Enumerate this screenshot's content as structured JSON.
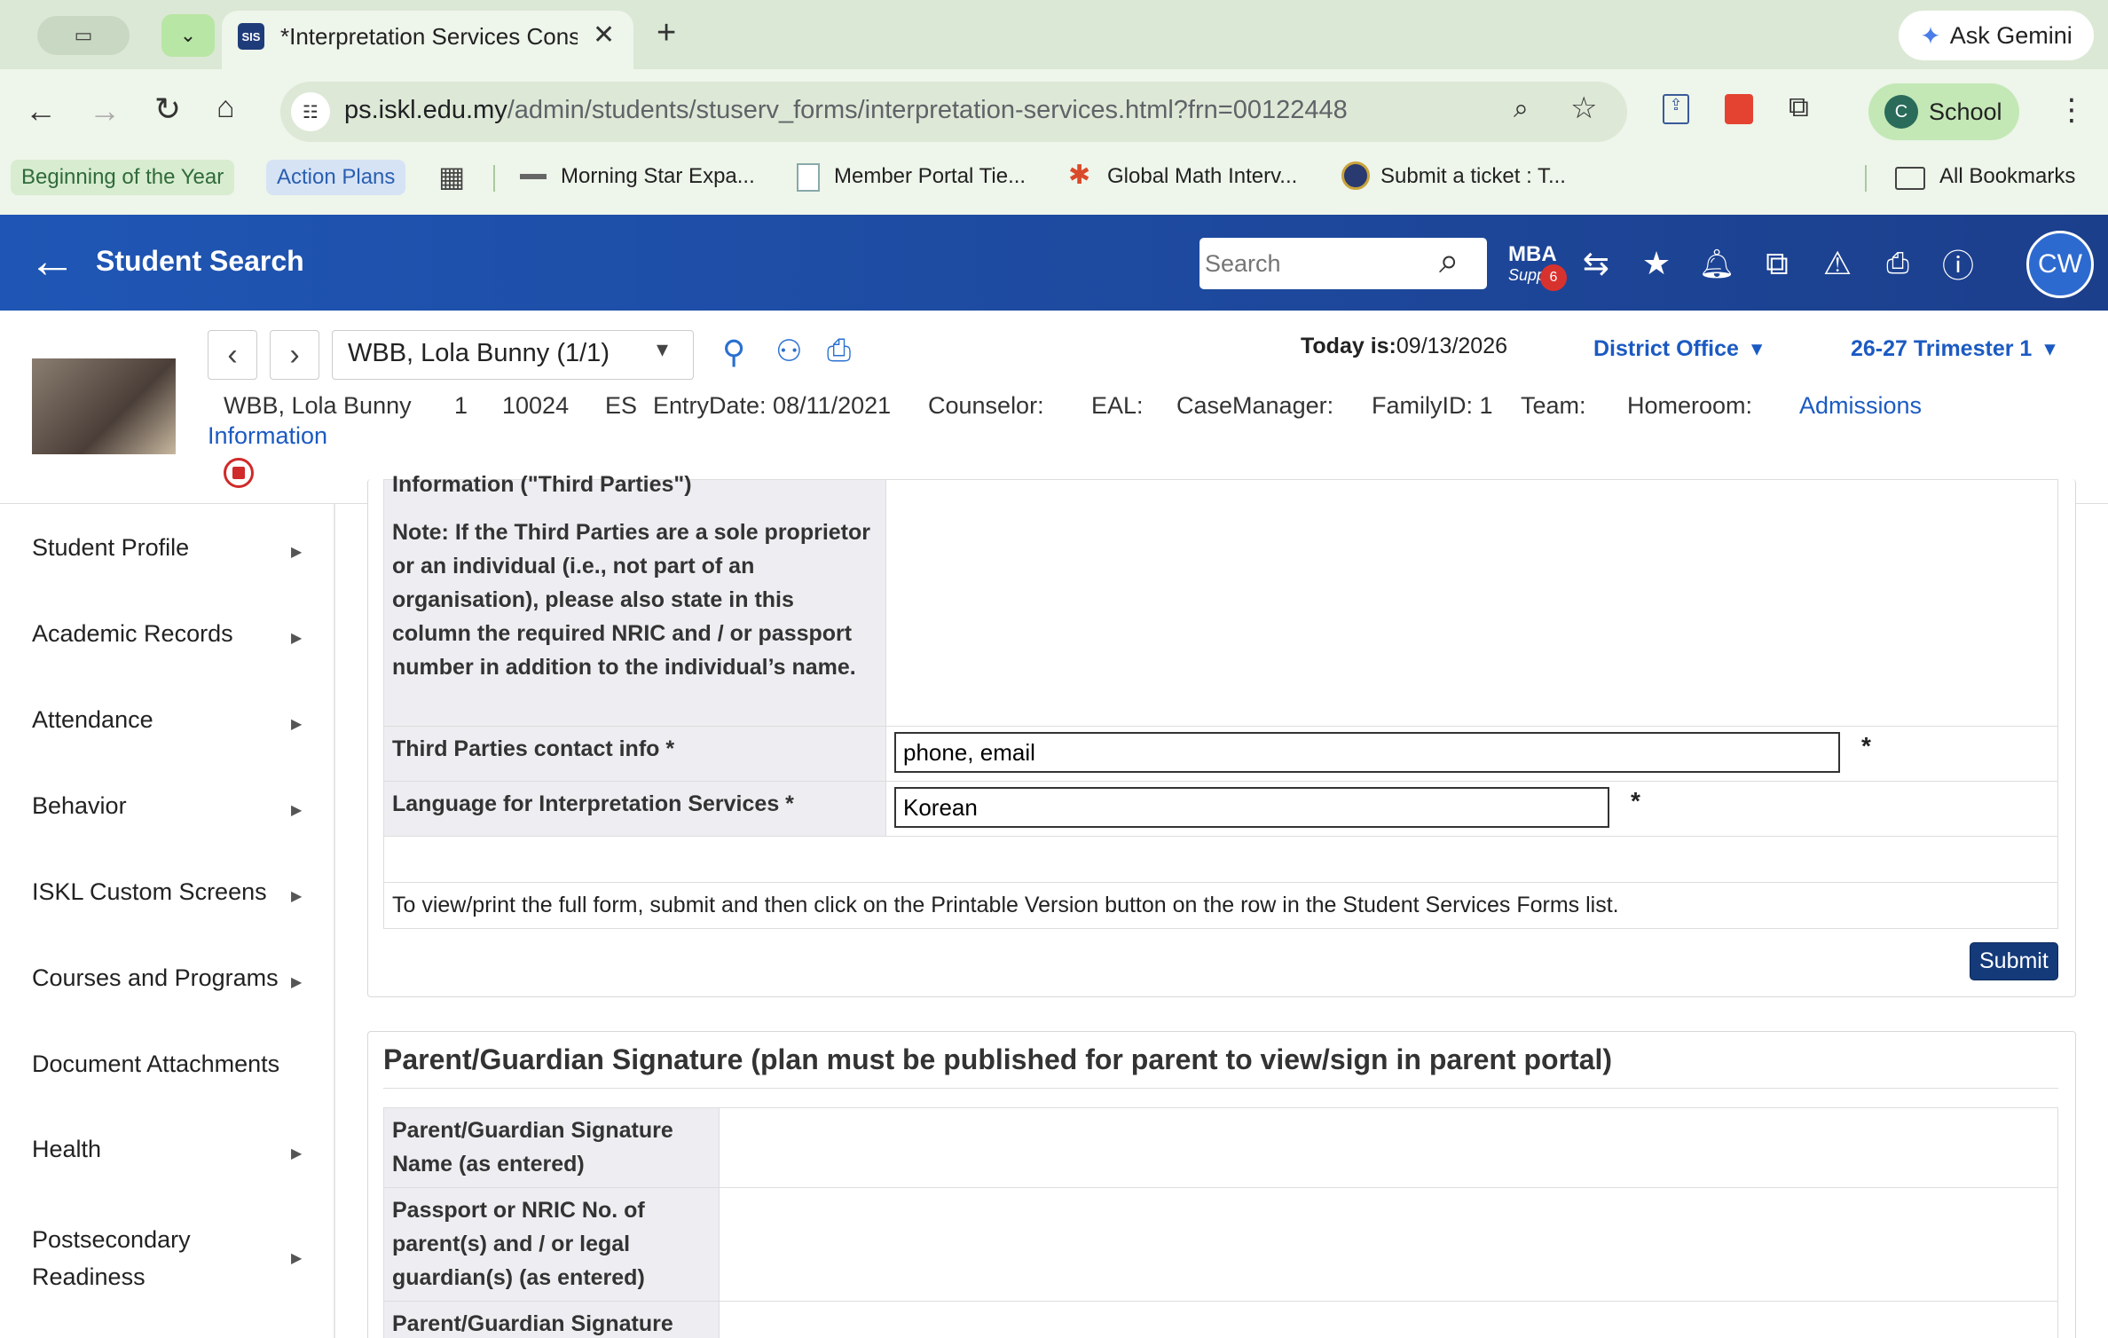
{
  "browser": {
    "tab_title": "*Interpretation Services Cons",
    "favicon_text": "SIS",
    "url_host": "ps.iskl.edu.my",
    "url_path": "/admin/students/stuserv_forms/interpretation-services.html?frn=00122448",
    "gemini_label": "Ask Gemini",
    "profile_label": "School",
    "profile_initial": "C",
    "bookmarks": {
      "beginning": "Beginning of the Year",
      "action_plans": "Action Plans",
      "morning_star": "Morning Star Expa...",
      "member_portal": "Member Portal Tie...",
      "global_math": "Global Math Interv...",
      "submit_ticket": "Submit a ticket : T...",
      "all_bookmarks": "All Bookmarks"
    }
  },
  "app": {
    "title": "Student Search",
    "search_placeholder": "Search",
    "mba_label": "MBA",
    "mba_sub": "Supp",
    "mba_badge": "6",
    "avatar_initials": "CW"
  },
  "student": {
    "select_label": "WBB, Lola Bunny  (1/1)",
    "today_label": "Today is:",
    "today_date": "09/13/2026",
    "school": "District Office",
    "term": "26-27 Trimester 1",
    "name": "WBB, Lola Bunny",
    "grade": "1",
    "id": "10024",
    "school_code": "ES",
    "entry_date": "EntryDate: 08/11/2021",
    "counselor": "Counselor:",
    "eal": "EAL:",
    "case_manager": "CaseManager:",
    "family_id": "FamilyID: 1",
    "team": "Team:",
    "homeroom": "Homeroom:",
    "admissions_link": "Admissions",
    "information_link": "Information"
  },
  "sidebar": {
    "items": [
      {
        "label": "Student Profile"
      },
      {
        "label": "Academic Records"
      },
      {
        "label": "Attendance"
      },
      {
        "label": "Behavior"
      },
      {
        "label": "ISKL Custom Screens"
      },
      {
        "label": "Courses and Programs"
      },
      {
        "label": "Document Attachments"
      },
      {
        "label": "Health"
      },
      {
        "label": "Postsecondary Readiness"
      }
    ]
  },
  "form": {
    "cut_label": "Information (\"Third Parties\")",
    "note_label": "Note: If the Third Parties are a sole proprietor or an individual (i.e., not part of an organisation), please also state in this column the required NRIC and / or passport number in addition to the individual’s name.",
    "contact_label": "Third Parties contact info *",
    "contact_value": "phone, email",
    "language_label": "Language for Interpretation Services *",
    "language_value": "Korean",
    "required_mark": "*",
    "footer_note": "To view/print the full form, submit and then click on the Printable Version button on the row in the Student Services Forms list.",
    "submit_label": "Submit"
  },
  "signature": {
    "heading": "Parent/Guardian Signature (plan must be published for parent to view/sign in parent portal)",
    "name_label": "Parent/Guardian Signature Name (as entered)",
    "passport_label": "Passport or NRIC No. of parent(s) and / or legal guardian(s) (as entered)",
    "sig_label": "Parent/Guardian Signature"
  }
}
